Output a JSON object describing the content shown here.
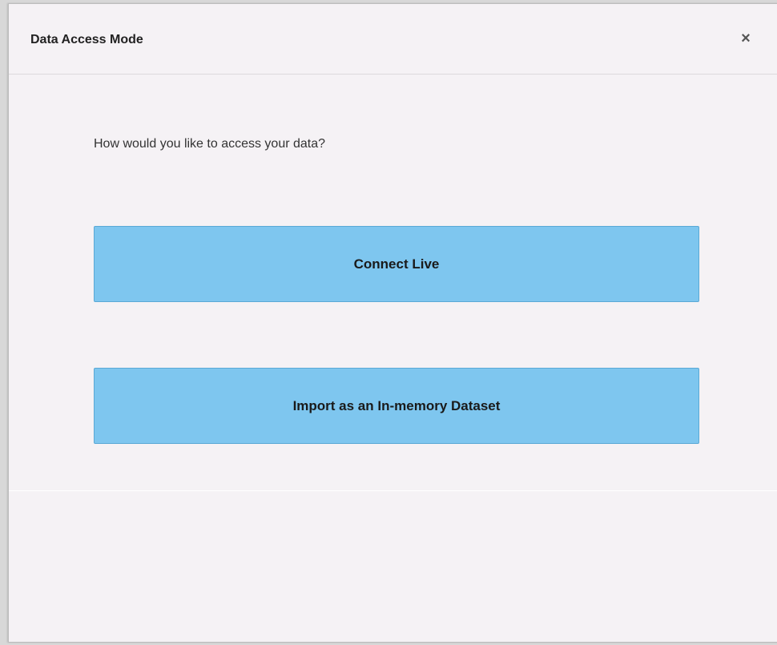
{
  "dialog": {
    "title": "Data Access Mode",
    "close_icon": "close-icon",
    "close_glyph": "×",
    "prompt": "How would you like to access your data?",
    "buttons": {
      "connect_live": "Connect Live",
      "import_dataset": "Import as an In-memory Dataset"
    }
  },
  "colors": {
    "button_bg": "#7ec6ef",
    "dialog_bg": "#f5f2f5"
  }
}
